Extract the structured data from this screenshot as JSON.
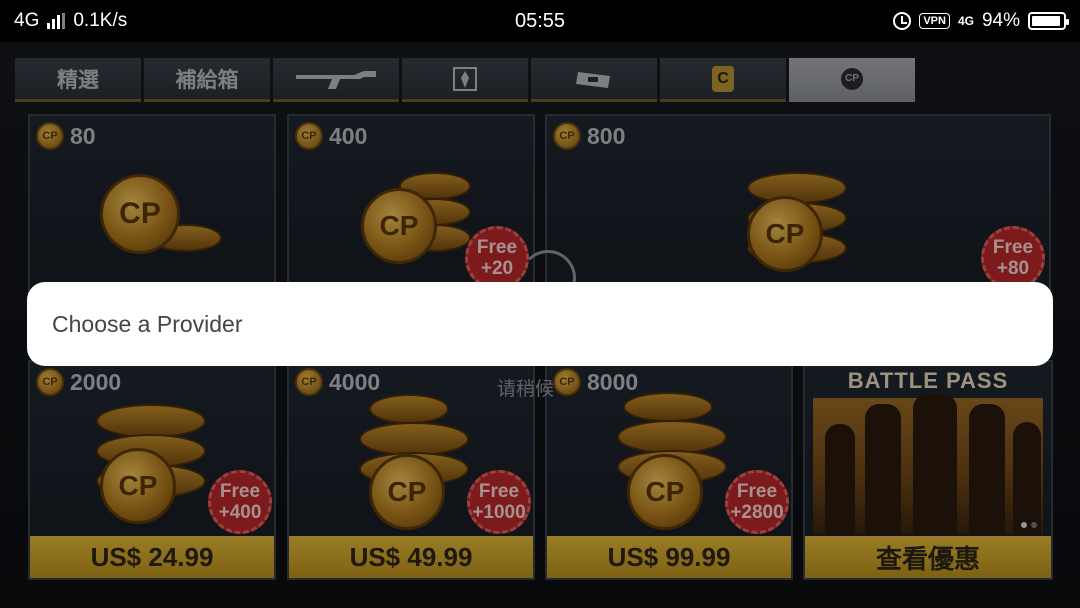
{
  "status_bar": {
    "network": "4G",
    "speed": "0.1K/s",
    "time": "05:55",
    "vpn": "VPN",
    "network2": "4G",
    "battery": "94%",
    "battery_level": 0.94
  },
  "tabs": [
    {
      "label": "精選",
      "icon": null
    },
    {
      "label": "補給箱",
      "icon": null
    },
    {
      "label": "",
      "icon": "rifle-icon"
    },
    {
      "label": "",
      "icon": "outfit-icon"
    },
    {
      "label": "",
      "icon": "ticket-icon"
    },
    {
      "label": "C",
      "icon": "c-badge-icon"
    },
    {
      "label": "CP",
      "icon": "cp-icon",
      "active": true
    }
  ],
  "cards": [
    {
      "amount": "80",
      "free": null,
      "price": null
    },
    {
      "amount": "400",
      "free": {
        "line1": "Free",
        "line2": "+20"
      },
      "price": null
    },
    {
      "amount": "800",
      "free": {
        "line1": "Free",
        "line2": "+80"
      },
      "price": null
    },
    {
      "amount": "2000",
      "free": {
        "line1": "Free",
        "line2": "+400"
      },
      "price": "US$ 24.99"
    },
    {
      "amount": "4000",
      "free": {
        "line1": "Free",
        "line2": "+1000"
      },
      "price": "US$ 49.99"
    },
    {
      "amount": "8000",
      "free": {
        "line1": "Free",
        "line2": "+2800"
      },
      "price": "US$ 99.99"
    }
  ],
  "coin_text": "CP",
  "battle_pass": {
    "title": "BATTLE PASS",
    "button": "查看優惠"
  },
  "waiting_text": "请稍候",
  "dialog": {
    "title": "Choose a Provider"
  }
}
